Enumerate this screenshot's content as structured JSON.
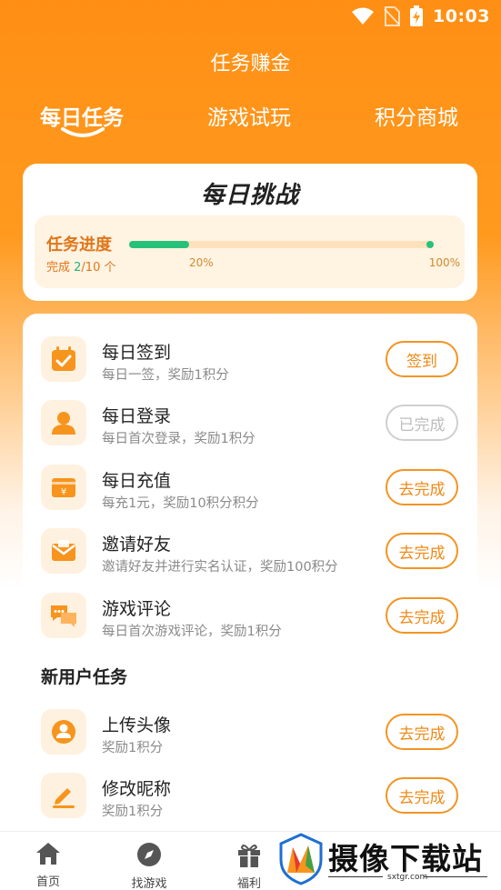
{
  "status_bar": {
    "time": "10:03"
  },
  "header": {
    "title": "任务赚金"
  },
  "tabs": [
    {
      "label": "每日任务",
      "active": true
    },
    {
      "label": "游戏试玩",
      "active": false
    },
    {
      "label": "积分商城",
      "active": false
    }
  ],
  "challenge": {
    "title": "每日挑战",
    "progress_label": "任务进度",
    "completed_prefix": "完成 ",
    "completed": "2",
    "total": "/10 个",
    "progress_fraction": 0.2,
    "percent_label": "20%",
    "max_label": "100%"
  },
  "daily_tasks": [
    {
      "title": "每日签到",
      "desc": "每日一签，奖励1积分",
      "button": "签到",
      "icon": "calendar-check-icon",
      "done": false
    },
    {
      "title": "每日登录",
      "desc": "每日首次登录，奖励1积分",
      "button": "已完成",
      "icon": "user-icon",
      "done": true
    },
    {
      "title": "每日充值",
      "desc": "每充1元，奖励10积分积分",
      "button": "去完成",
      "icon": "wallet-icon",
      "done": false
    },
    {
      "title": "邀请好友",
      "desc": "邀请好友并进行实名认证，奖励100积分",
      "button": "去完成",
      "icon": "envelope-icon",
      "done": false
    },
    {
      "title": "游戏评论",
      "desc": "每日首次游戏评论，奖励1积分",
      "button": "去完成",
      "icon": "comment-icon",
      "done": false
    }
  ],
  "new_user_section": {
    "title": "新用户任务"
  },
  "new_user_tasks": [
    {
      "title": "上传头像",
      "desc": "奖励1积分",
      "button": "去完成",
      "icon": "avatar-icon",
      "done": false
    },
    {
      "title": "修改昵称",
      "desc": "奖励1积分",
      "button": "去完成",
      "icon": "pencil-icon",
      "done": false
    }
  ],
  "bottom_nav": [
    {
      "label": "首页",
      "icon": "home-icon"
    },
    {
      "label": "找游戏",
      "icon": "compass-icon"
    },
    {
      "label": "福利",
      "icon": "gift-icon"
    }
  ],
  "watermark": {
    "text": "摄像下载站",
    "url": "sxtgr.com"
  },
  "colors": {
    "accent": "#ff9a1f",
    "button": "#f39422",
    "progress": "#27c27a"
  }
}
